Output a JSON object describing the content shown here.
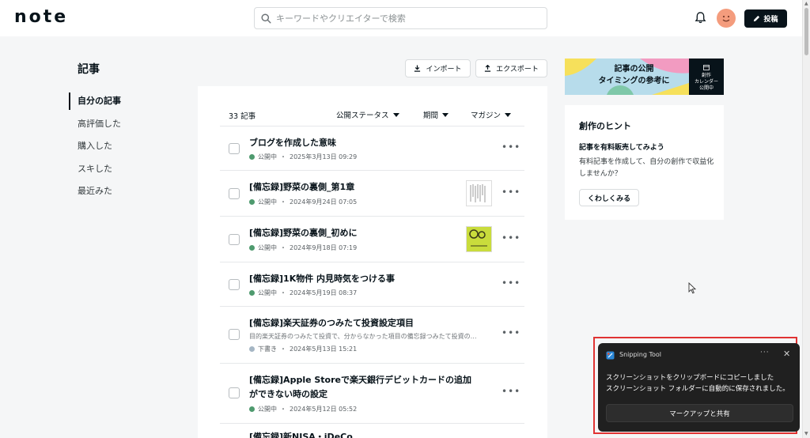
{
  "header": {
    "logo": "note",
    "search_placeholder": "キーワードやクリエイターで検索",
    "post_label": "投稿"
  },
  "sidebar": {
    "title": "記事",
    "items": [
      {
        "label": "自分の記事",
        "active": true
      },
      {
        "label": "高評価した"
      },
      {
        "label": "購入した"
      },
      {
        "label": "スキした"
      },
      {
        "label": "最近みた"
      }
    ]
  },
  "actions": {
    "import_label": "インポート",
    "export_label": "エクスポート"
  },
  "list_header": {
    "count": "33 記事",
    "filters": [
      "公開ステータス",
      "期間",
      "マガジン"
    ]
  },
  "articles": [
    {
      "title": "ブログを作成した意味",
      "status": "公開中",
      "date": "2025年3月13日 09:29"
    },
    {
      "title": "[備忘録]野菜の裏側_第1章",
      "status": "公開中",
      "date": "2024年9月24日 07:05"
    },
    {
      "title": "[備忘録]野菜の裏側_初めに",
      "status": "公開中",
      "date": "2024年9月18日 07:19"
    },
    {
      "title": "[備忘録]1K物件 内見時気をつける事",
      "status": "公開中",
      "date": "2024年5月19日 08:37"
    },
    {
      "title": "[備忘録]楽天証券のつみたて投資設定項目",
      "desc": "目的楽天証券のつみたて投資で、分からなかった項目の備忘録つみたて投資の…",
      "status": "下書き",
      "date": "2024年5月13日 15:21"
    },
    {
      "title_line1": "[備忘録]Apple Storeで楽天銀行デビットカードの追加",
      "title_line2": "ができない時の設定",
      "status": "公開中",
      "date": "2024年5月12日 05:52"
    },
    {
      "title": "[備忘録]新NISA・iDeCo"
    }
  ],
  "banner": {
    "line1": "記事の公開",
    "line2": "タイミングの参考に",
    "badge_line1": "創作",
    "badge_line2": "カレンダー",
    "badge_line3": "公開中"
  },
  "hint": {
    "title": "創作のヒント",
    "subtitle": "記事を有料販売してみよう",
    "body": "有料記事を作成して、自分の創作で収益化しませんか？",
    "button": "くわしくみる"
  },
  "toast": {
    "app": "Snipping Tool",
    "line1": "スクリーンショットをクリップボードにコピーしました",
    "line2": "スクリーンショット フォルダーに自動的に保存されました。",
    "button": "マークアップと共有"
  }
}
